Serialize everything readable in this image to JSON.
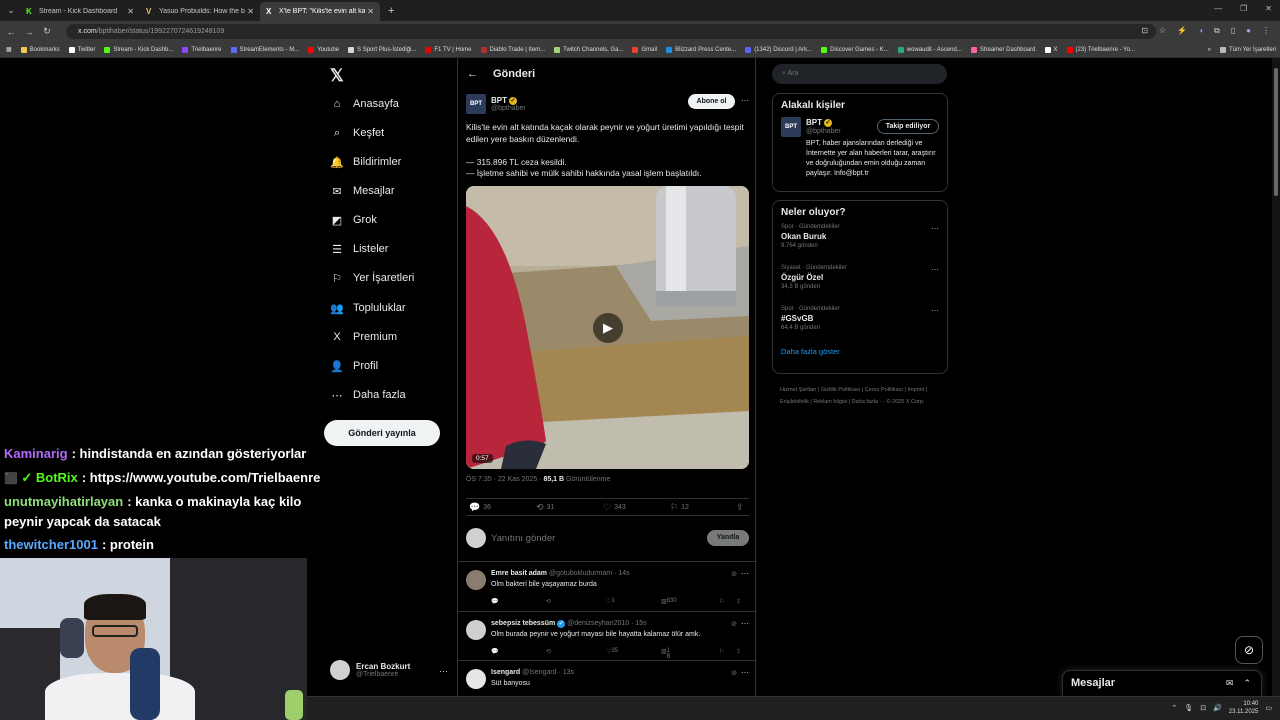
{
  "browser": {
    "tabs": [
      {
        "label": "Stream - Kick Dashboard",
        "fav": "K",
        "fav_color": "#53fc18",
        "active": false
      },
      {
        "label": "Yasuo Probuilds: How the best",
        "fav": "V",
        "fav_color": "#e2c16b",
        "active": false
      },
      {
        "label": "X'te BPT: \"Kilis'te evin alt katında",
        "fav": "X",
        "fav_color": "#ffffff",
        "active": true
      }
    ],
    "url_host": "x.com",
    "url_path": "/bptihaber/status/1992270724619248109",
    "bookmarks": [
      {
        "label": "Bookmarks",
        "color": "#f2c94c"
      },
      {
        "label": "Twitter",
        "color": "#ffffff"
      },
      {
        "label": "Stream - Kick Dashb...",
        "color": "#53fc18"
      },
      {
        "label": "Trielbaenre",
        "color": "#9146ff"
      },
      {
        "label": "StreamElements - M...",
        "color": "#5b6cff"
      },
      {
        "label": "Youtube",
        "color": "#ff0000"
      },
      {
        "label": "S Sport Plus-İstediği...",
        "color": "#d6d6d6"
      },
      {
        "label": "F1 TV | Home",
        "color": "#e10600"
      },
      {
        "label": "Diablo Trade | Item...",
        "color": "#b0302b"
      },
      {
        "label": "Twitch Channels, Ga...",
        "color": "#9fd27a"
      },
      {
        "label": "Gmail",
        "color": "#ea4335"
      },
      {
        "label": "Blizzard Press Cente...",
        "color": "#1c8fe6"
      },
      {
        "label": "(1342) Discord | Ark...",
        "color": "#5865f2"
      },
      {
        "label": "Discover Games - K...",
        "color": "#53fc18"
      },
      {
        "label": "wowaudit - Ascend...",
        "color": "#2aa876"
      },
      {
        "label": "Streamer Dashboard",
        "color": "#ff5fa2"
      },
      {
        "label": "X",
        "color": "#ffffff"
      },
      {
        "label": "(23) Trielbaenre - Yo...",
        "color": "#ff0000"
      }
    ],
    "all_bookmarks": "Tüm Yer İşaretleri"
  },
  "nav": {
    "items": [
      {
        "icon": "⌂",
        "label": "Anasayfa"
      },
      {
        "icon": "⌕",
        "label": "Keşfet"
      },
      {
        "icon": "🔔",
        "label": "Bildirimler"
      },
      {
        "icon": "✉",
        "label": "Mesajlar"
      },
      {
        "icon": "◩",
        "label": "Grok"
      },
      {
        "icon": "☰",
        "label": "Listeler"
      },
      {
        "icon": "⚐",
        "label": "Yer İşaretleri"
      },
      {
        "icon": "👥",
        "label": "Topluluklar"
      },
      {
        "icon": "X",
        "label": "Premium"
      },
      {
        "icon": "👤",
        "label": "Profil"
      },
      {
        "icon": "⋯",
        "label": "Daha fazla"
      }
    ],
    "post_button": "Gönderi yayınla",
    "account_name": "Ercan Bozkurt",
    "account_handle": "@Trielbaenre"
  },
  "post": {
    "header_title": "Gönderi",
    "author_name": "BPT",
    "author_handle": "@bpthaber",
    "avatar_text": "BPT",
    "subscribe_label": "Abone ol",
    "text": "Kilis'te evin alt katında kaçak olarak peynir ve yoğurt üretimi yapıldığı tespit edilen yere baskın düzenlendi.\n\n— 315.896 TL ceza kesildi.\n— İşletme sahibi ve mülk sahibi hakkında yasal işlem başlatıldı.",
    "video_duration": "0:57",
    "timestamp": "ÖS 7:35 · 22 Kas 2025 · ",
    "views": "85,1 B",
    "views_label": " Görüntülenme",
    "replies": "36",
    "reposts": "31",
    "likes": "343",
    "bookmarks": "12",
    "reply_placeholder": "Yanıtını gönder",
    "reply_button": "Yanıtla"
  },
  "replies": [
    {
      "name": "Emre basit adam",
      "handle": "@gotubokludurmam · 14s",
      "text": "Olm bakteri bile yaşayamaz burda",
      "likes": "1",
      "views": "830",
      "verified": false
    },
    {
      "name": "sebepsiz tebessüm",
      "handle": "@denizseyhan2010 · 15s",
      "text": "Olm burada peynir ve yoğurt mayası bile hayatta kalamaz ölür amk.",
      "likes": "35",
      "views": "1 B",
      "verified": true
    },
    {
      "name": "Isengard",
      "handle": "@Isengard · 13s",
      "text": "Süt banyosu",
      "likes": "",
      "views": "",
      "verified": false
    }
  ],
  "right": {
    "search_placeholder": "Ara",
    "related_title": "Alakalı kişiler",
    "rel_name": "BPT",
    "rel_handle": "@bpthaber",
    "rel_follow": "Takip ediliyor",
    "rel_bio": "BPT, haber ajanslarından derlediği ve İnternette yer alan haberleri tarar, araştırır ve doğruluğundan emin olduğu zaman paylaşır. Info@bpt.tr",
    "trends_title": "Neler oluyor?",
    "trends": [
      {
        "category": "Spor · Gündemdekiler",
        "name": "Okan Buruk",
        "posts": "9.764 gönderi"
      },
      {
        "category": "Siyaset · Gündemdekiler",
        "name": "Özgür Özel",
        "posts": "34,3 B gönderi"
      },
      {
        "category": "Spor · Gündemdekiler",
        "name": "#GSvGB",
        "posts": "64,4 B gönderi"
      }
    ],
    "show_more": "Daha fazla göster",
    "footer": "Hizmet Şartları  |  Gizlilik Politikası  |  Çerez Politikası  |  Imprint  |  Erişilebilirlik  |  Reklam bilgisi  |  Daha fazla ···  © 2025 X Corp."
  },
  "messages_bar": "Mesajlar",
  "chat": [
    {
      "user": "Kaminarig",
      "color": "#b36bff",
      "text": ": hindistanda en azından gösteriyorlar",
      "badge": ""
    },
    {
      "user": "BotRix",
      "color": "#53fc18",
      "text": ": https://www.youtube.com/Trielbaenre",
      "badge": "✓"
    },
    {
      "user": "unutmayihatirlayan",
      "color": "#8ee07a",
      "text": ": kanka o makinayla kaç kilo",
      "badge": ""
    },
    {
      "user": "",
      "color": "#ffffff",
      "text": "peynir yapcak da satacak",
      "badge": ""
    },
    {
      "user": "thewitcher1001",
      "color": "#5aa8ff",
      "text": ": protein",
      "badge": ""
    }
  ],
  "clock": {
    "time": "10:40",
    "date": "23.11.2025"
  }
}
